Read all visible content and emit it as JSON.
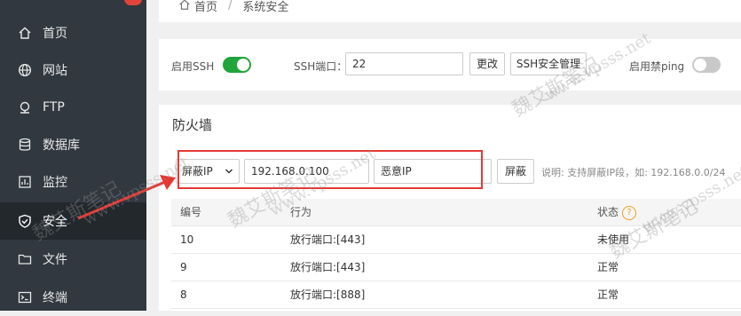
{
  "sidebar": {
    "items": [
      {
        "label": "首页",
        "icon": "home-icon"
      },
      {
        "label": "网站",
        "icon": "globe-icon"
      },
      {
        "label": "FTP",
        "icon": "ftp-icon"
      },
      {
        "label": "数据库",
        "icon": "database-icon"
      },
      {
        "label": "监控",
        "icon": "monitor-icon"
      },
      {
        "label": "安全",
        "icon": "shield-icon",
        "active": true
      },
      {
        "label": "文件",
        "icon": "folder-icon"
      },
      {
        "label": "终端",
        "icon": "terminal-icon"
      }
    ]
  },
  "breadcrumb": {
    "home": "首页",
    "separator": "/",
    "current": "系统安全"
  },
  "ssh": {
    "enable_label": "启用SSH",
    "enabled": true,
    "port_label": "SSH端口：",
    "port_value": "22",
    "change_button": "更改",
    "manage_button": "SSH安全管理",
    "ping_label": "启用禁ping",
    "ping_enabled": false
  },
  "firewall": {
    "title": "防火墙",
    "type_select": "屏蔽IP",
    "ip_value": "192.168.0.100",
    "remark_value": "恶意IP",
    "block_button": "屏蔽",
    "hint": "说明: 支持屏蔽IP段，如: 192.168.0.0/24",
    "columns": [
      "编号",
      "行为",
      "状态"
    ],
    "rows": [
      {
        "id": "10",
        "action": "放行端口:[443]",
        "status": "未使用"
      },
      {
        "id": "9",
        "action": "放行端口:[443]",
        "status": "正常"
      },
      {
        "id": "8",
        "action": "放行端口:[888]",
        "status": "正常"
      }
    ]
  },
  "watermark": {
    "name": "魏艾斯笔记",
    "url": "www.vpsss.net"
  },
  "colors": {
    "sidebar": "#31383f",
    "toggle_on": "#20a53a",
    "highlight": "#e53935",
    "help": "#f0a020"
  }
}
